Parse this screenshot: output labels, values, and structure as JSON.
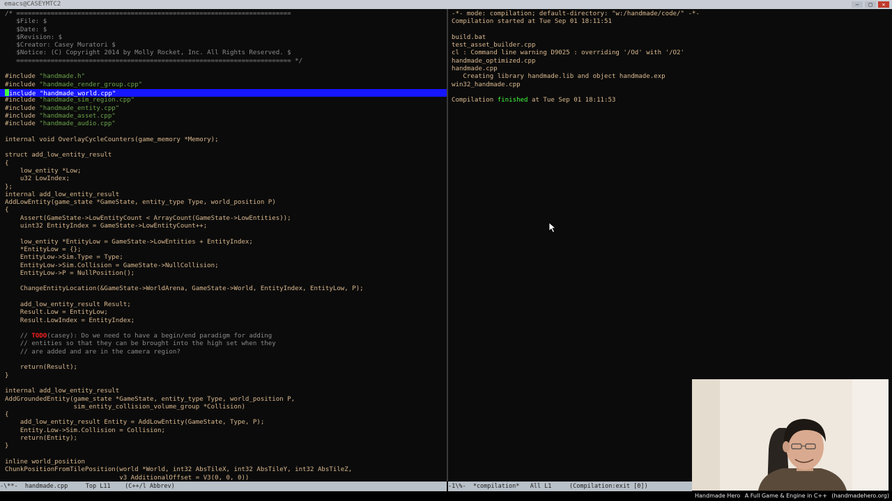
{
  "window": {
    "title": "emacs@CASEYMTC2"
  },
  "left_pane": {
    "lines": [
      "/* ========================================================================",
      "   $File: $",
      "   $Date: $",
      "   $Revision: $",
      "   $Creator: Casey Muratori $",
      "   $Notice: (C) Copyright 2014 by Molly Rocket, Inc. All Rights Reserved. $",
      "   ======================================================================== */",
      "",
      "#include \"handmade.h\"",
      "#include \"handmade_render_group.cpp\"",
      "#include \"handmade_world.cpp\"",
      "#include \"handmade_sim_region.cpp\"",
      "#include \"handmade_entity.cpp\"",
      "#include \"handmade_asset.cpp\"",
      "#include \"handmade_audio.cpp\"",
      "",
      "internal void OverlayCycleCounters(game_memory *Memory);",
      "",
      "struct add_low_entity_result",
      "{",
      "    low_entity *Low;",
      "    u32 LowIndex;",
      "};",
      "internal add_low_entity_result",
      "AddLowEntity(game_state *GameState, entity_type Type, world_position P)",
      "{",
      "    Assert(GameState->LowEntityCount < ArrayCount(GameState->LowEntities));",
      "    uint32 EntityIndex = GameState->LowEntityCount++;",
      "",
      "    low_entity *EntityLow = GameState->LowEntities + EntityIndex;",
      "    *EntityLow = {};",
      "    EntityLow->Sim.Type = Type;",
      "    EntityLow->Sim.Collision = GameState->NullCollision;",
      "    EntityLow->P = NullPosition();",
      "",
      "    ChangeEntityLocation(&GameState->WorldArena, GameState->World, EntityIndex, EntityLow, P);",
      "",
      "    add_low_entity_result Result;",
      "    Result.Low = EntityLow;",
      "    Result.LowIndex = EntityIndex;",
      "",
      "    // TODO(casey): Do we need to have a begin/end paradigm for adding",
      "    // entities so that they can be brought into the high set when they",
      "    // are added and are in the camera region?",
      "",
      "    return(Result);",
      "}",
      "",
      "internal add_low_entity_result",
      "AddGroundedEntity(game_state *GameState, entity_type Type, world_position P,",
      "                  sim_entity_collision_volume_group *Collision)",
      "{",
      "    add_low_entity_result Entity = AddLowEntity(GameState, Type, P);",
      "    Entity.Low->Sim.Collision = Collision;",
      "    return(Entity);",
      "}",
      "",
      "inline world_position",
      "ChunkPositionFromTilePosition(world *World, int32 AbsTileX, int32 AbsTileY, int32 AbsTileZ,",
      "                              v3 AdditionalOffset = V3(0, 0, 0))"
    ],
    "highlighted_line": 10,
    "modeline": "-\\**-  handmade.cpp     Top L11    (C++/l Abbrev)"
  },
  "right_pane": {
    "lines": [
      "-*- mode: compilation; default-directory: \"w:/handmade/code/\" -*-",
      "Compilation started at Tue Sep 01 18:11:51",
      "",
      "build.bat",
      "test_asset_builder.cpp",
      "cl : Command line warning D9025 : overriding '/Od' with '/O2'",
      "handmade_optimized.cpp",
      "handmade.cpp",
      "   Creating library handmade.lib and object handmade.exp",
      "win32_handmade.cpp",
      "",
      "Compilation finished at Tue Sep 01 18:11:53"
    ],
    "modeline": "-1\\%-  *compilation*   All L1     (Compilation:exit [0])"
  },
  "footer": {
    "left": "Handmade Hero",
    "middle": "A Full Game & Engine in C++",
    "right": "(handmadehero.org)"
  },
  "colors": {
    "background": "#0b0b0b",
    "code_text": "#dab98f",
    "comment": "#8a8a8a",
    "string": "#6ba34a",
    "highlight": "#1616ff",
    "success": "#40ff40",
    "todo": "#ff2020"
  }
}
